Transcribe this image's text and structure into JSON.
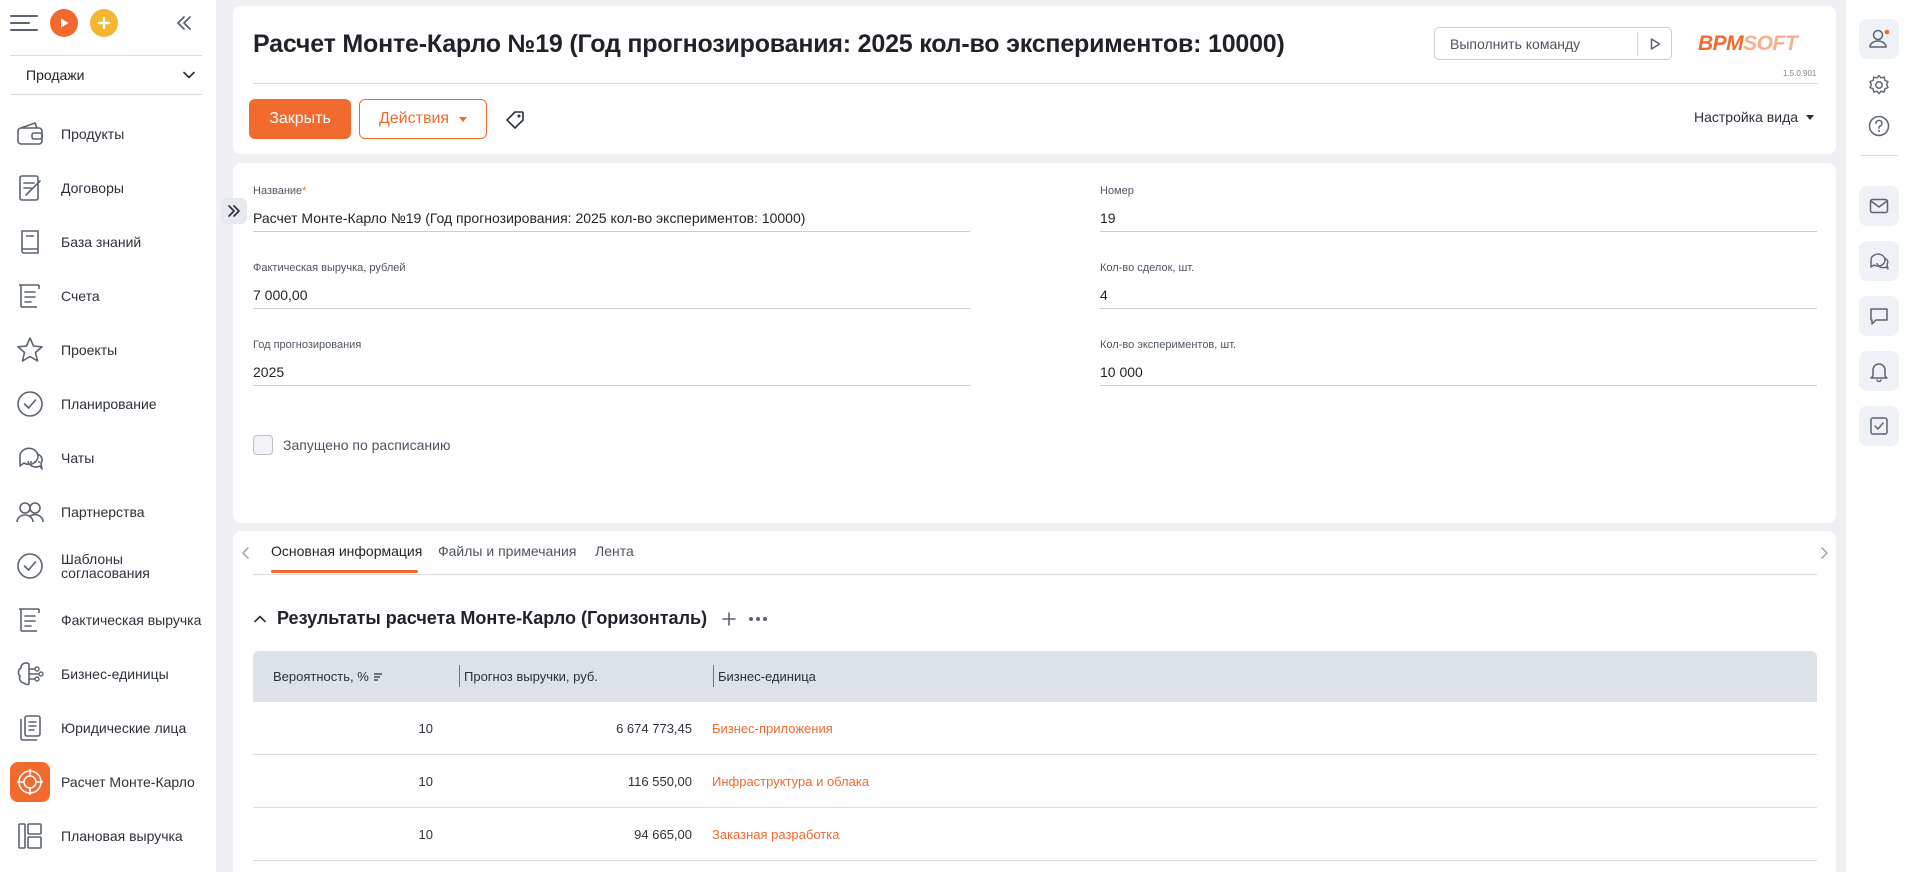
{
  "sidebar": {
    "workplace": "Продажи",
    "items": [
      {
        "label": "Продукты",
        "icon": "wallet-icon"
      },
      {
        "label": "Договоры",
        "icon": "contract-icon"
      },
      {
        "label": "База знаний",
        "icon": "book-icon"
      },
      {
        "label": "Счета",
        "icon": "invoice-icon"
      },
      {
        "label": "Проекты",
        "icon": "star-icon"
      },
      {
        "label": "Планирование",
        "icon": "check-circle-icon"
      },
      {
        "label": "Чаты",
        "icon": "chat-icon"
      },
      {
        "label": "Партнерства",
        "icon": "partners-icon"
      },
      {
        "label": "Шаблоны согласования",
        "icon": "check-circle-icon"
      },
      {
        "label": "Фактическая выручка",
        "icon": "invoice-icon"
      },
      {
        "label": "Бизнес-единицы",
        "icon": "brain-icon"
      },
      {
        "label": "Юридические лица",
        "icon": "documents-icon"
      },
      {
        "label": "Расчет Монте-Карло",
        "icon": "target-icon",
        "active": true
      },
      {
        "label": "Плановая выручка",
        "icon": "layout-icon"
      }
    ]
  },
  "header": {
    "title": "Расчет Монте-Карло №19 (Год прогнозирования: 2025 кол-во экспериментов: 10000)",
    "command_placeholder": "Выполнить команду",
    "logo_main": "BPM",
    "logo_soft": "SOFT",
    "version": "1.5.0.901",
    "close_label": "Закрыть",
    "actions_label": "Действия",
    "view_settings_label": "Настройка вида"
  },
  "fields": {
    "name": {
      "label": "Название",
      "required_mark": "*",
      "value": "Расчет Монте-Карло №19 (Год прогнозирования: 2025 кол-во экспериментов: 10000)"
    },
    "number": {
      "label": "Номер",
      "value": "19"
    },
    "actual_revenue": {
      "label": "Фактическая выручка, рублей",
      "value": "7 000,00"
    },
    "deals_count": {
      "label": "Кол-во сделок, шт.",
      "value": "4"
    },
    "forecast_year": {
      "label": "Год прогнозирования",
      "value": "2025"
    },
    "experiments_count": {
      "label": "Кол-во экспериментов, шт.",
      "value": "10 000"
    },
    "scheduled": {
      "label": "Запущено по расписанию",
      "checked": false
    }
  },
  "tabs": [
    {
      "label": "Основная информация",
      "active": true
    },
    {
      "label": "Файлы и примечания"
    },
    {
      "label": "Лента"
    }
  ],
  "detail": {
    "title": "Результаты расчета Монте-Карло (Горизонталь)",
    "columns": [
      "Вероятность, %",
      "Прогноз выручки, руб.",
      "Бизнес-единица"
    ],
    "rows": [
      {
        "probability": "10",
        "forecast": "6 674 773,45",
        "unit": "Бизнес-приложения"
      },
      {
        "probability": "10",
        "forecast": "116 550,00",
        "unit": "Инфраструктура и облака"
      },
      {
        "probability": "10",
        "forecast": "94 665,00",
        "unit": "Заказная разработка"
      }
    ]
  },
  "colors": {
    "accent": "#f26a2e",
    "play": "#f26a2e",
    "add": "#f5b630"
  }
}
